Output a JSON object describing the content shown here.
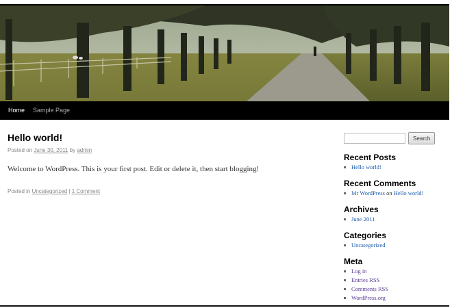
{
  "nav": {
    "items": [
      {
        "label": "Home"
      },
      {
        "label": "Sample Page"
      }
    ]
  },
  "post": {
    "title": "Hello world!",
    "meta_prefix": "Posted on",
    "date": "June 30, 2011",
    "meta_by": "by",
    "author": "admin",
    "content": "Welcome to WordPress. This is your first post. Edit or delete it, then start blogging!",
    "footer_prefix": "Posted in",
    "category": "Uncategorized",
    "footer_sep": "|",
    "comments_link": "1 Comment"
  },
  "sidebar": {
    "search_placeholder": "",
    "search_button": "Search",
    "recent_posts": {
      "title": "Recent Posts",
      "items": [
        "Hello world!"
      ]
    },
    "recent_comments": {
      "title": "Recent Comments",
      "author": "Mr WordPress",
      "on": "on",
      "post": "Hello world!"
    },
    "archives": {
      "title": "Archives",
      "items": [
        "June 2011"
      ]
    },
    "categories": {
      "title": "Categories",
      "items": [
        "Uncategorized"
      ]
    },
    "meta": {
      "title": "Meta",
      "items": [
        "Log in",
        "Entries RSS",
        "Comments RSS",
        "WordPress.org"
      ]
    }
  },
  "colors": {
    "link_blue": "#1b5cab",
    "link_visited": "#5a3b96",
    "navbar_bg": "#000000"
  }
}
